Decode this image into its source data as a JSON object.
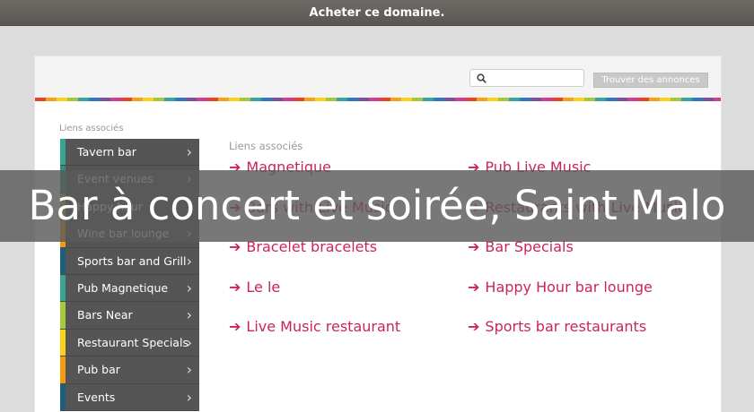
{
  "topbar": {
    "text": "Acheter ce domaine."
  },
  "search": {
    "placeholder": "",
    "button_label": "Trouver des annonces"
  },
  "colors": {
    "link": "#c9255b",
    "sidebar": "#555555",
    "stripe": [
      "#e8412c",
      "#f3a31a",
      "#f7d417",
      "#a3c93a",
      "#36a4a0",
      "#2b7bbf",
      "#7e4fa1",
      "#d23c8f"
    ]
  },
  "sidebar": {
    "title": "Liens associés",
    "items": [
      {
        "label": "Tavern bar",
        "color": "#36a48f"
      },
      {
        "label": "Event venues",
        "color": "#2e8f80"
      },
      {
        "label": "Happy hour restaurant",
        "color": "#a6c93a"
      },
      {
        "label": "Wine bar lounge",
        "color": "#f39c12"
      },
      {
        "label": "Sports bar and Grill",
        "color": "#1f5e78"
      },
      {
        "label": "Pub Magnetique",
        "color": "#36a48f"
      },
      {
        "label": "Bars Near",
        "color": "#a6c93a"
      },
      {
        "label": "Restaurant Specials",
        "color": "#f7d417"
      },
      {
        "label": "Pub bar",
        "color": "#f39c12"
      },
      {
        "label": "Events",
        "color": "#1f5e78"
      }
    ]
  },
  "content": {
    "title": "Liens associés",
    "links_left": [
      "Magnetique",
      "Bars with Live Music",
      "Bracelet bracelets",
      "Le le",
      "Live Music restaurant"
    ],
    "links_right": [
      "Pub Live Music",
      "Restaurants with Live Music",
      "Bar Specials",
      "Happy Hour bar lounge",
      "Sports bar restaurants"
    ]
  },
  "banner": {
    "text": "Bar à concert et soirée, Saint Malo"
  }
}
